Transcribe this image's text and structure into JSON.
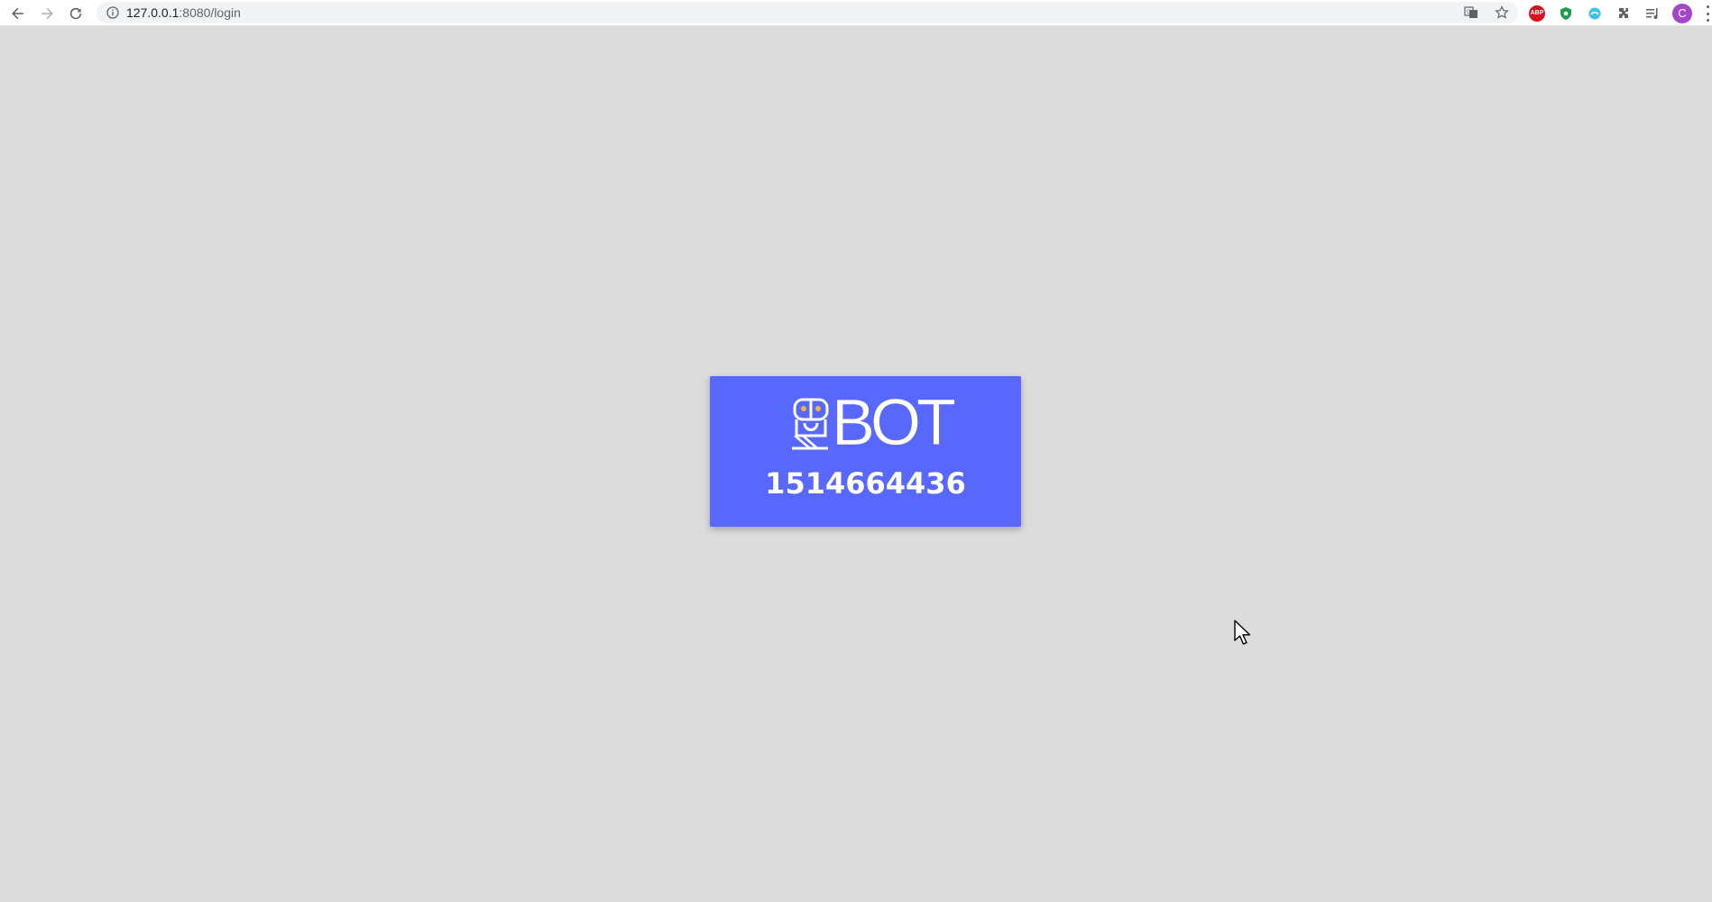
{
  "browser": {
    "url_host": "127.0.0.1",
    "url_rest": ":8080/login",
    "nav": {
      "back_icon": "arrow-left-icon",
      "forward_icon": "arrow-right-icon",
      "reload_icon": "reload-icon"
    },
    "omnibox_icons": [
      "translate-icon",
      "star-icon"
    ],
    "extensions": [
      "adblock-plus-icon",
      "shield-extension-icon",
      "swirl-extension-icon",
      "puzzle-icon",
      "media-queue-icon"
    ],
    "abp_label": "ABP",
    "profile_initial": "C"
  },
  "login_card": {
    "logo_text": "BOT",
    "login_code": "1514664436",
    "background_color": "#5867fc"
  },
  "page": {
    "background_color": "#dcdcdc"
  }
}
